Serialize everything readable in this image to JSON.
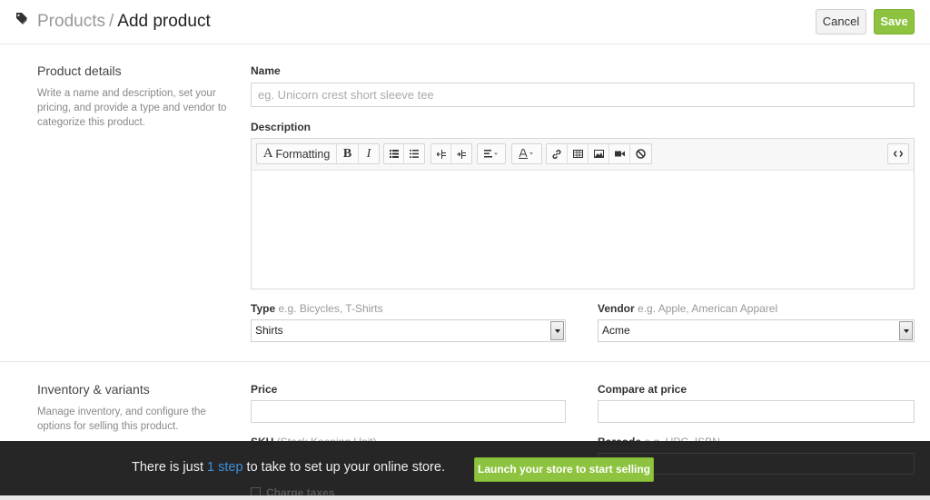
{
  "header": {
    "breadcrumb_parent": "Products",
    "breadcrumb_separator": "/",
    "breadcrumb_current": "Add product",
    "cancel_label": "Cancel",
    "save_label": "Save"
  },
  "product_details": {
    "title": "Product details",
    "description": "Write a name and description, set your pricing, and provide a type and vendor to categorize this product.",
    "name_label": "Name",
    "name_placeholder": "eg. Unicorn crest short sleeve tee",
    "name_value": "",
    "description_label": "Description",
    "toolbar": {
      "formatting_label": "Formatting",
      "formatting_icon_glyph": "A",
      "bold_glyph": "B",
      "italic_glyph": "I"
    },
    "type_label": "Type",
    "type_hint": "e.g. Bicycles, T-Shirts",
    "type_value": "Shirts",
    "vendor_label": "Vendor",
    "vendor_hint": "e.g. Apple, American Apparel",
    "vendor_value": "Acme"
  },
  "inventory": {
    "title": "Inventory & variants",
    "description": "Manage inventory, and configure the options for selling this product.",
    "price_label": "Price",
    "price_value": "",
    "compare_label": "Compare at price",
    "compare_value": "",
    "sku_label": "SKU",
    "sku_hint": "(Stock Keeping Unit)",
    "barcode_label": "Barcode",
    "barcode_hint": "e.g. UPC, ISBN",
    "charge_taxes_label": "Charge taxes",
    "charge_taxes_checked": true
  },
  "banner": {
    "text_before": "There is just",
    "link_text": "1 step",
    "text_after": "to take to set up your online store.",
    "button_label": "Launch your store to start selling"
  },
  "colors": {
    "accent_green": "#8dc33f",
    "link_blue": "#3f8fd9",
    "banner_bg": "#222222"
  }
}
